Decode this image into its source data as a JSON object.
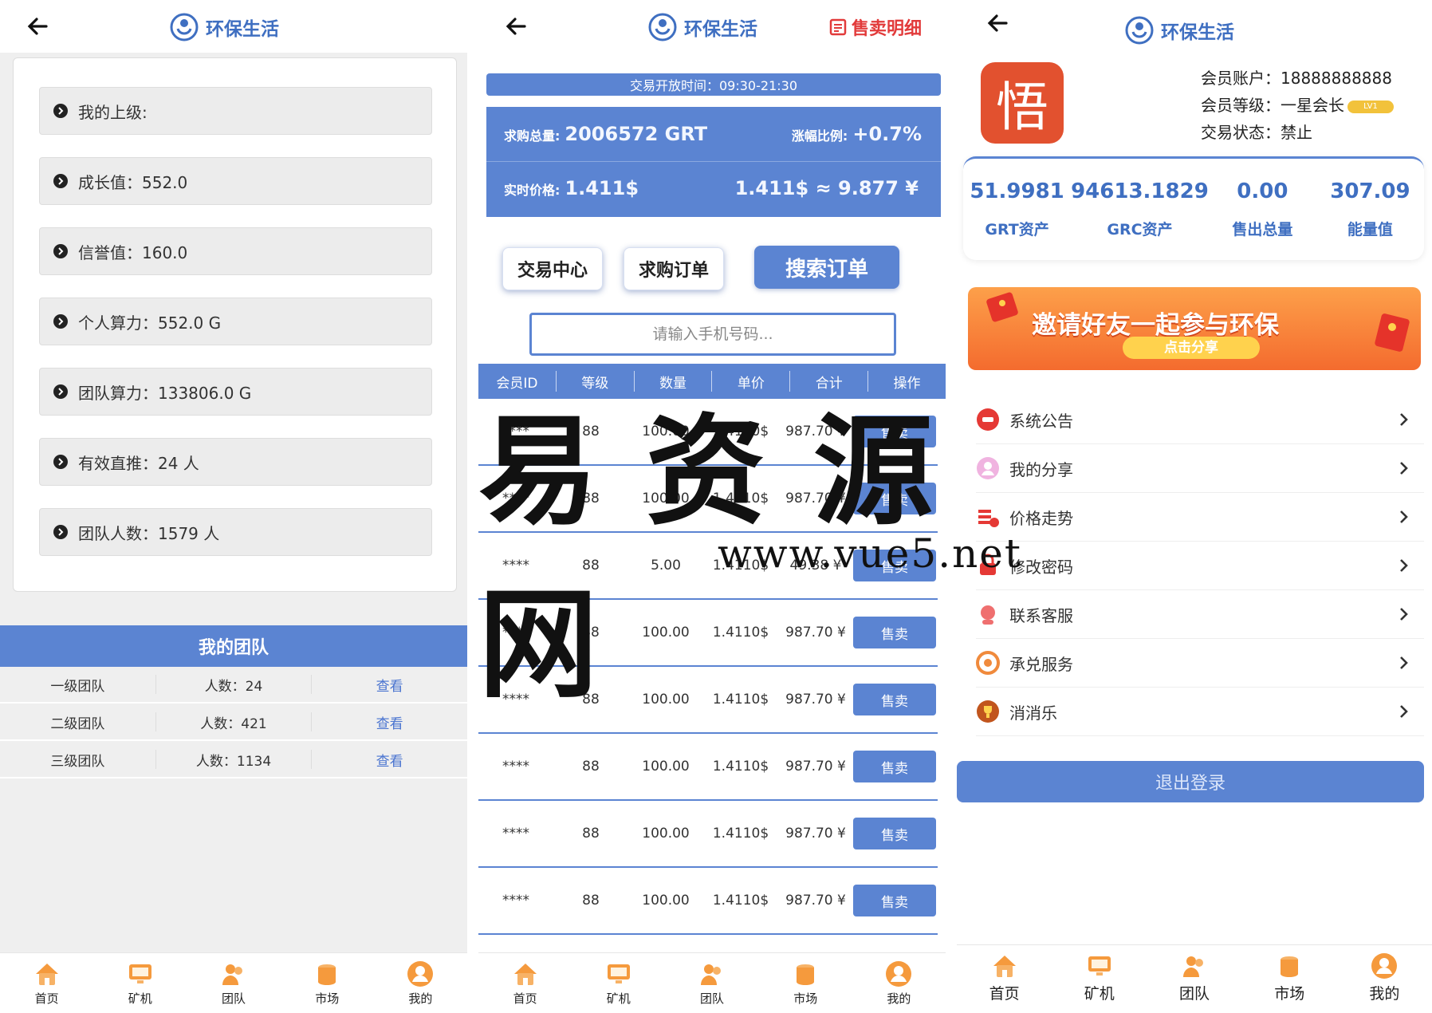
{
  "brand": "环保生活",
  "panel1": {
    "info_rows": [
      "我的上级:",
      "成长值：552.0",
      "信誉值：160.0",
      "个人算力：552.0 G",
      "团队算力：133806.0 G",
      "有效直推：24 人",
      "团队人数：1579 人"
    ],
    "team_title": "我的团队",
    "team_rows": [
      {
        "level": "一级团队",
        "count": "人数：24",
        "action": "查看"
      },
      {
        "level": "二级团队",
        "count": "人数：421",
        "action": "查看"
      },
      {
        "level": "三级团队",
        "count": "人数：1134",
        "action": "查看"
      }
    ]
  },
  "panel2": {
    "sell_detail": "售卖明细",
    "hours": "交易开放时间：09:30-21:30",
    "stats": {
      "total_label": "求购总量:",
      "total_value": "2006572 GRT",
      "rate_label": "涨幅比例:",
      "rate_value": "+0.7%",
      "price_label": "实时价格:",
      "price_value": "1.411$",
      "conversion": "1.411$ ≈ 9.877 ¥"
    },
    "tabs": [
      "交易中心",
      "求购订单"
    ],
    "search_button": "搜索订单",
    "search_placeholder": "请输入手机号码...",
    "columns": [
      "会员ID",
      "等级",
      "数量",
      "单价",
      "合计",
      "操作"
    ],
    "rows": [
      {
        "id": "****",
        "level": "88",
        "qty": "100.00",
        "price": "1.4110$",
        "total": "987.70 ¥",
        "op": "售卖"
      },
      {
        "id": "****",
        "level": "88",
        "qty": "100.00",
        "price": "1.4110$",
        "total": "987.70 ¥",
        "op": "售卖"
      },
      {
        "id": "****",
        "level": "88",
        "qty": "5.00",
        "price": "1.4110$",
        "total": "49.38 ¥",
        "op": "售卖"
      },
      {
        "id": "****",
        "level": "88",
        "qty": "100.00",
        "price": "1.4110$",
        "total": "987.70 ¥",
        "op": "售卖"
      },
      {
        "id": "****",
        "level": "88",
        "qty": "100.00",
        "price": "1.4110$",
        "total": "987.70 ¥",
        "op": "售卖"
      },
      {
        "id": "****",
        "level": "88",
        "qty": "100.00",
        "price": "1.4110$",
        "total": "987.70 ¥",
        "op": "售卖"
      },
      {
        "id": "****",
        "level": "88",
        "qty": "100.00",
        "price": "1.4110$",
        "total": "987.70 ¥",
        "op": "售卖"
      },
      {
        "id": "****",
        "level": "88",
        "qty": "100.00",
        "price": "1.4110$",
        "total": "987.70 ¥",
        "op": "售卖"
      }
    ]
  },
  "panel3": {
    "avatar_char": "悟",
    "account": "会员账户：18888888888",
    "level": "会员等级：一星会长",
    "level_badge": "LV1",
    "status": "交易状态：禁止",
    "assets": [
      {
        "value": "51.9981",
        "label": "GRT资产"
      },
      {
        "value": "94613.1829",
        "label": "GRC资产"
      },
      {
        "value": "0.00",
        "label": "售出总量"
      },
      {
        "value": "307.09",
        "label": "能量值"
      }
    ],
    "banner_title": "邀请好友一起参与环保",
    "banner_share": "点击分享",
    "menu": [
      {
        "label": "系统公告",
        "icon": "notice-icon",
        "color": "#e53935"
      },
      {
        "label": "我的分享",
        "icon": "share-icon",
        "color": "#e580c8"
      },
      {
        "label": "价格走势",
        "icon": "chart-icon",
        "color": "#e53935"
      },
      {
        "label": "修改密码",
        "icon": "lock-icon",
        "color": "#e53935"
      },
      {
        "label": "联系客服",
        "icon": "service-icon",
        "color": "#ef6f6f"
      },
      {
        "label": "承兑服务",
        "icon": "exchange-icon",
        "color": "#f08a3c"
      },
      {
        "label": "消消乐",
        "icon": "trophy-icon",
        "color": "#c1551d"
      }
    ],
    "logout": "退出登录"
  },
  "tabbar": [
    "首页",
    "矿机",
    "团队",
    "市场",
    "我的"
  ],
  "watermark": {
    "title": "易资源网",
    "url": "www.vue5.net"
  },
  "colors": {
    "primary": "#5b84d2",
    "brand_text": "#3f6fc1",
    "danger": "#e23b3b",
    "tab_icon": "#f59a3d"
  }
}
